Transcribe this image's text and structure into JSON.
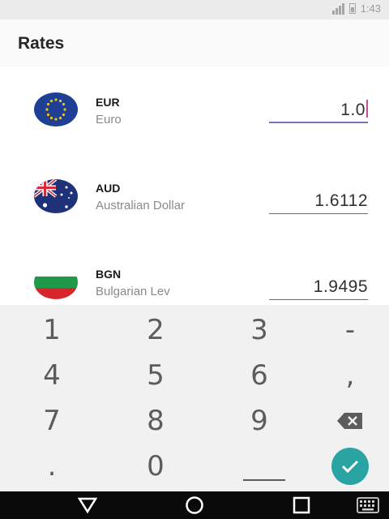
{
  "status_bar": {
    "time": "1:43"
  },
  "app_bar": {
    "title": "Rates"
  },
  "currencies": [
    {
      "code": "EUR",
      "name": "Euro",
      "amount": "1.0",
      "active": true
    },
    {
      "code": "AUD",
      "name": "Australian Dollar",
      "amount": "1.6112",
      "active": false
    },
    {
      "code": "BGN",
      "name": "Bulgarian Lev",
      "amount": "1.9495",
      "active": false
    }
  ],
  "keypad": {
    "keys": [
      "1",
      "2",
      "3",
      "-",
      "4",
      "5",
      "6",
      ",",
      "7",
      "8",
      "9",
      "backspace",
      ".",
      "0",
      "space",
      "done"
    ]
  },
  "colors": {
    "accent": "#2aa3a3",
    "underline_active": "#7a74b6",
    "cursor": "#c44fa0",
    "keypad_bg": "#f1f1f1"
  },
  "icons": [
    "signal-icon",
    "battery-icon",
    "eu-flag-icon",
    "au-flag-icon",
    "bg-flag-icon",
    "backspace-icon",
    "checkmark-icon",
    "back-icon",
    "home-icon",
    "recents-icon",
    "keyboard-icon"
  ]
}
